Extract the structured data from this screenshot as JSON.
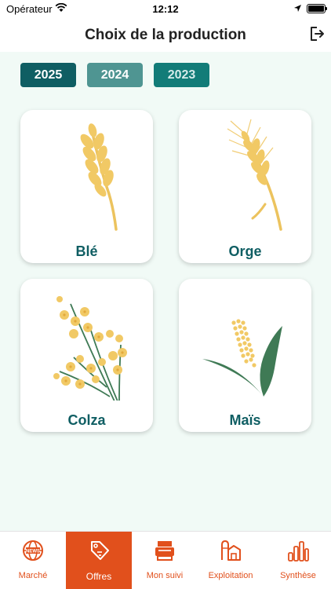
{
  "status_bar": {
    "carrier": "Opérateur",
    "time": "12:12"
  },
  "header": {
    "title": "Choix de la production"
  },
  "years": [
    "2025",
    "2024",
    "2023"
  ],
  "productions": [
    {
      "label": "Blé",
      "icon": "wheat-icon"
    },
    {
      "label": "Orge",
      "icon": "barley-icon"
    },
    {
      "label": "Colza",
      "icon": "rapeseed-icon"
    },
    {
      "label": "Maïs",
      "icon": "corn-icon"
    }
  ],
  "tabs": [
    {
      "label": "Marché",
      "icon": "globe-news-icon"
    },
    {
      "label": "Offres",
      "icon": "price-tag-icon",
      "active": true
    },
    {
      "label": "Mon suivi",
      "icon": "printer-tray-icon"
    },
    {
      "label": "Exploitation",
      "icon": "barn-silo-icon"
    },
    {
      "label": "Synthèse",
      "icon": "bar-chart-icon"
    }
  ],
  "colors": {
    "primary": "#0f5e63",
    "accent": "#e1501c",
    "background": "#f1faf6",
    "crop": "#f0c763",
    "leaf": "#3f7a55"
  }
}
